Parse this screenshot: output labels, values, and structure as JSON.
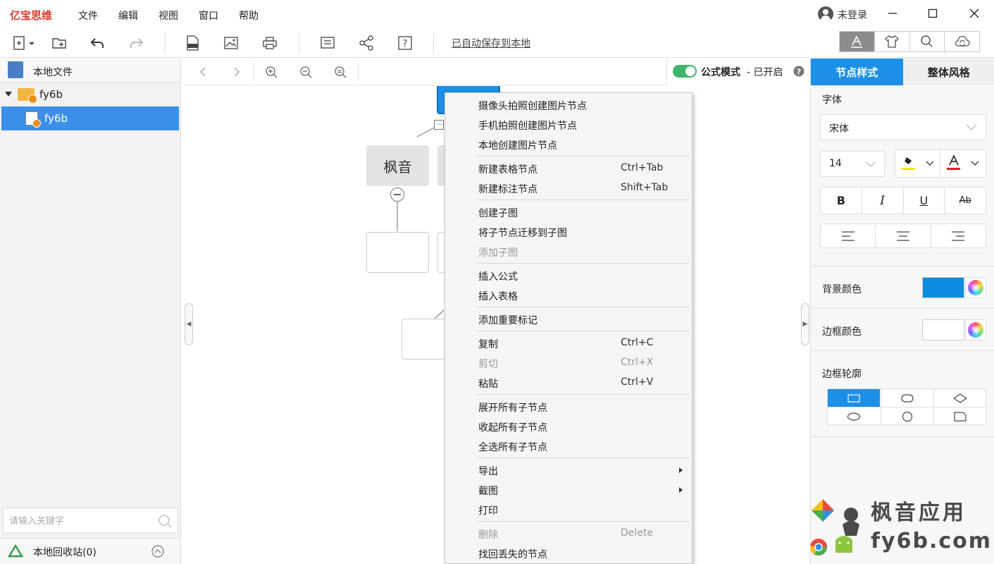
{
  "app": {
    "name": "亿宝思维",
    "menus": [
      "文件",
      "编辑",
      "视图",
      "窗口",
      "帮助"
    ],
    "user_label": "未登录"
  },
  "toolbar": {
    "autosave_label": "已自动保存到本地"
  },
  "left_panel": {
    "header": "本地文件",
    "folder": "fy6b",
    "file": "fy6b",
    "search_placeholder": "请输入关键字",
    "recycle_label": "本地回收站(0)"
  },
  "canvas": {
    "node_main": "枫音",
    "formula_label": "公式模式",
    "formula_status": "- 已开启"
  },
  "right_panel": {
    "tabs": [
      "节点样式",
      "整体风格"
    ],
    "font_label": "字体",
    "font_value": "宋体",
    "font_size": "14",
    "bold": "B",
    "italic": "I",
    "underline": "U",
    "strike": "Ab",
    "bg_color_label": "背景颜色",
    "bg_color": "#0a8de0",
    "border_color_label": "边框颜色",
    "border_color": "#ffffff",
    "border_shape_label": "边框轮廓",
    "highlight_color": "#f5e400",
    "font_color": "#e02020"
  },
  "context_menu": {
    "items": [
      {
        "label": "摄像头拍照创建图片节点",
        "shortcut": ""
      },
      {
        "label": "手机拍照创建图片节点",
        "shortcut": ""
      },
      {
        "label": "本地创建图片节点",
        "shortcut": ""
      },
      {
        "label": "新建表格节点",
        "shortcut": "Ctrl+Tab"
      },
      {
        "label": "新建标注节点",
        "shortcut": "Shift+Tab"
      },
      {
        "label": "创建子图",
        "shortcut": ""
      },
      {
        "label": "将子节点迁移到子图",
        "shortcut": ""
      },
      {
        "label": "添加子图",
        "shortcut": ""
      },
      {
        "label": "插入公式",
        "shortcut": ""
      },
      {
        "label": "插入表格",
        "shortcut": ""
      },
      {
        "label": "添加重要标记",
        "shortcut": ""
      },
      {
        "label": "复制",
        "shortcut": "Ctrl+C"
      },
      {
        "label": "剪切",
        "shortcut": "Ctrl+X"
      },
      {
        "label": "粘贴",
        "shortcut": "Ctrl+V"
      },
      {
        "label": "展开所有子节点",
        "shortcut": ""
      },
      {
        "label": "收起所有子节点",
        "shortcut": ""
      },
      {
        "label": "全选所有子节点",
        "shortcut": ""
      },
      {
        "label": "导出",
        "shortcut": ""
      },
      {
        "label": "截图",
        "shortcut": ""
      },
      {
        "label": "打印",
        "shortcut": ""
      },
      {
        "label": "删除",
        "shortcut": "Delete"
      },
      {
        "label": "找回丢失的节点",
        "shortcut": ""
      }
    ]
  },
  "watermark": {
    "line1": "枫音应用",
    "line2": "fy6b.com"
  }
}
